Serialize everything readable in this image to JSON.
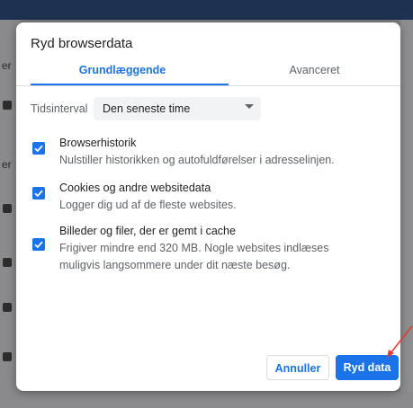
{
  "dialog": {
    "title": "Ryd browserdata",
    "tabs": [
      {
        "label": "Grundlæggende",
        "active": true
      },
      {
        "label": "Avanceret",
        "active": false
      }
    ],
    "time_range": {
      "label": "Tidsinterval",
      "selected": "Den seneste time"
    },
    "options": [
      {
        "title": "Browserhistorik",
        "description": "Nulstiller historikken og autofuldførelser i adresselinjen.",
        "checked": true
      },
      {
        "title": "Cookies og andre websitedata",
        "description": "Logger dig ud af de fleste websites.",
        "checked": true
      },
      {
        "title": "Billeder og filer, der er gemt i cache",
        "description": "Frigiver mindre end 320 MB. Nogle websites indlæses muligvis langsommere under dit næste besøg.",
        "checked": true
      }
    ],
    "buttons": {
      "cancel": "Annuller",
      "clear": "Ryd data"
    }
  },
  "colors": {
    "accent": "#1a73e8",
    "annotation_arrow": "#e53935"
  }
}
